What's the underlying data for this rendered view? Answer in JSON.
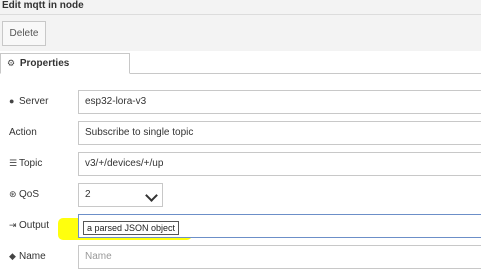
{
  "header": {
    "title": "Edit mqtt in node"
  },
  "toolbar": {
    "delete_label": "Delete"
  },
  "tabs": [
    {
      "label": "Properties",
      "icon": "gear-icon"
    }
  ],
  "fields": {
    "server": {
      "label": "Server",
      "icon": "globe-icon",
      "value": "esp32-lora-v3"
    },
    "action": {
      "label": "Action",
      "value": "Subscribe to single topic"
    },
    "topic": {
      "label": "Topic",
      "icon": "tasks-icon",
      "value": "v3/+/devices/+/up"
    },
    "qos": {
      "label": "QoS",
      "icon": "empire-icon",
      "value": "2"
    },
    "output": {
      "label": "Output",
      "icon": "sign-out-icon",
      "value": "a parsed JSON object"
    },
    "name": {
      "label": "Name",
      "icon": "tag-icon",
      "placeholder": "Name"
    }
  },
  "colors": {
    "highlight": "#ffff00",
    "focus_border": "#6c8fc8"
  }
}
